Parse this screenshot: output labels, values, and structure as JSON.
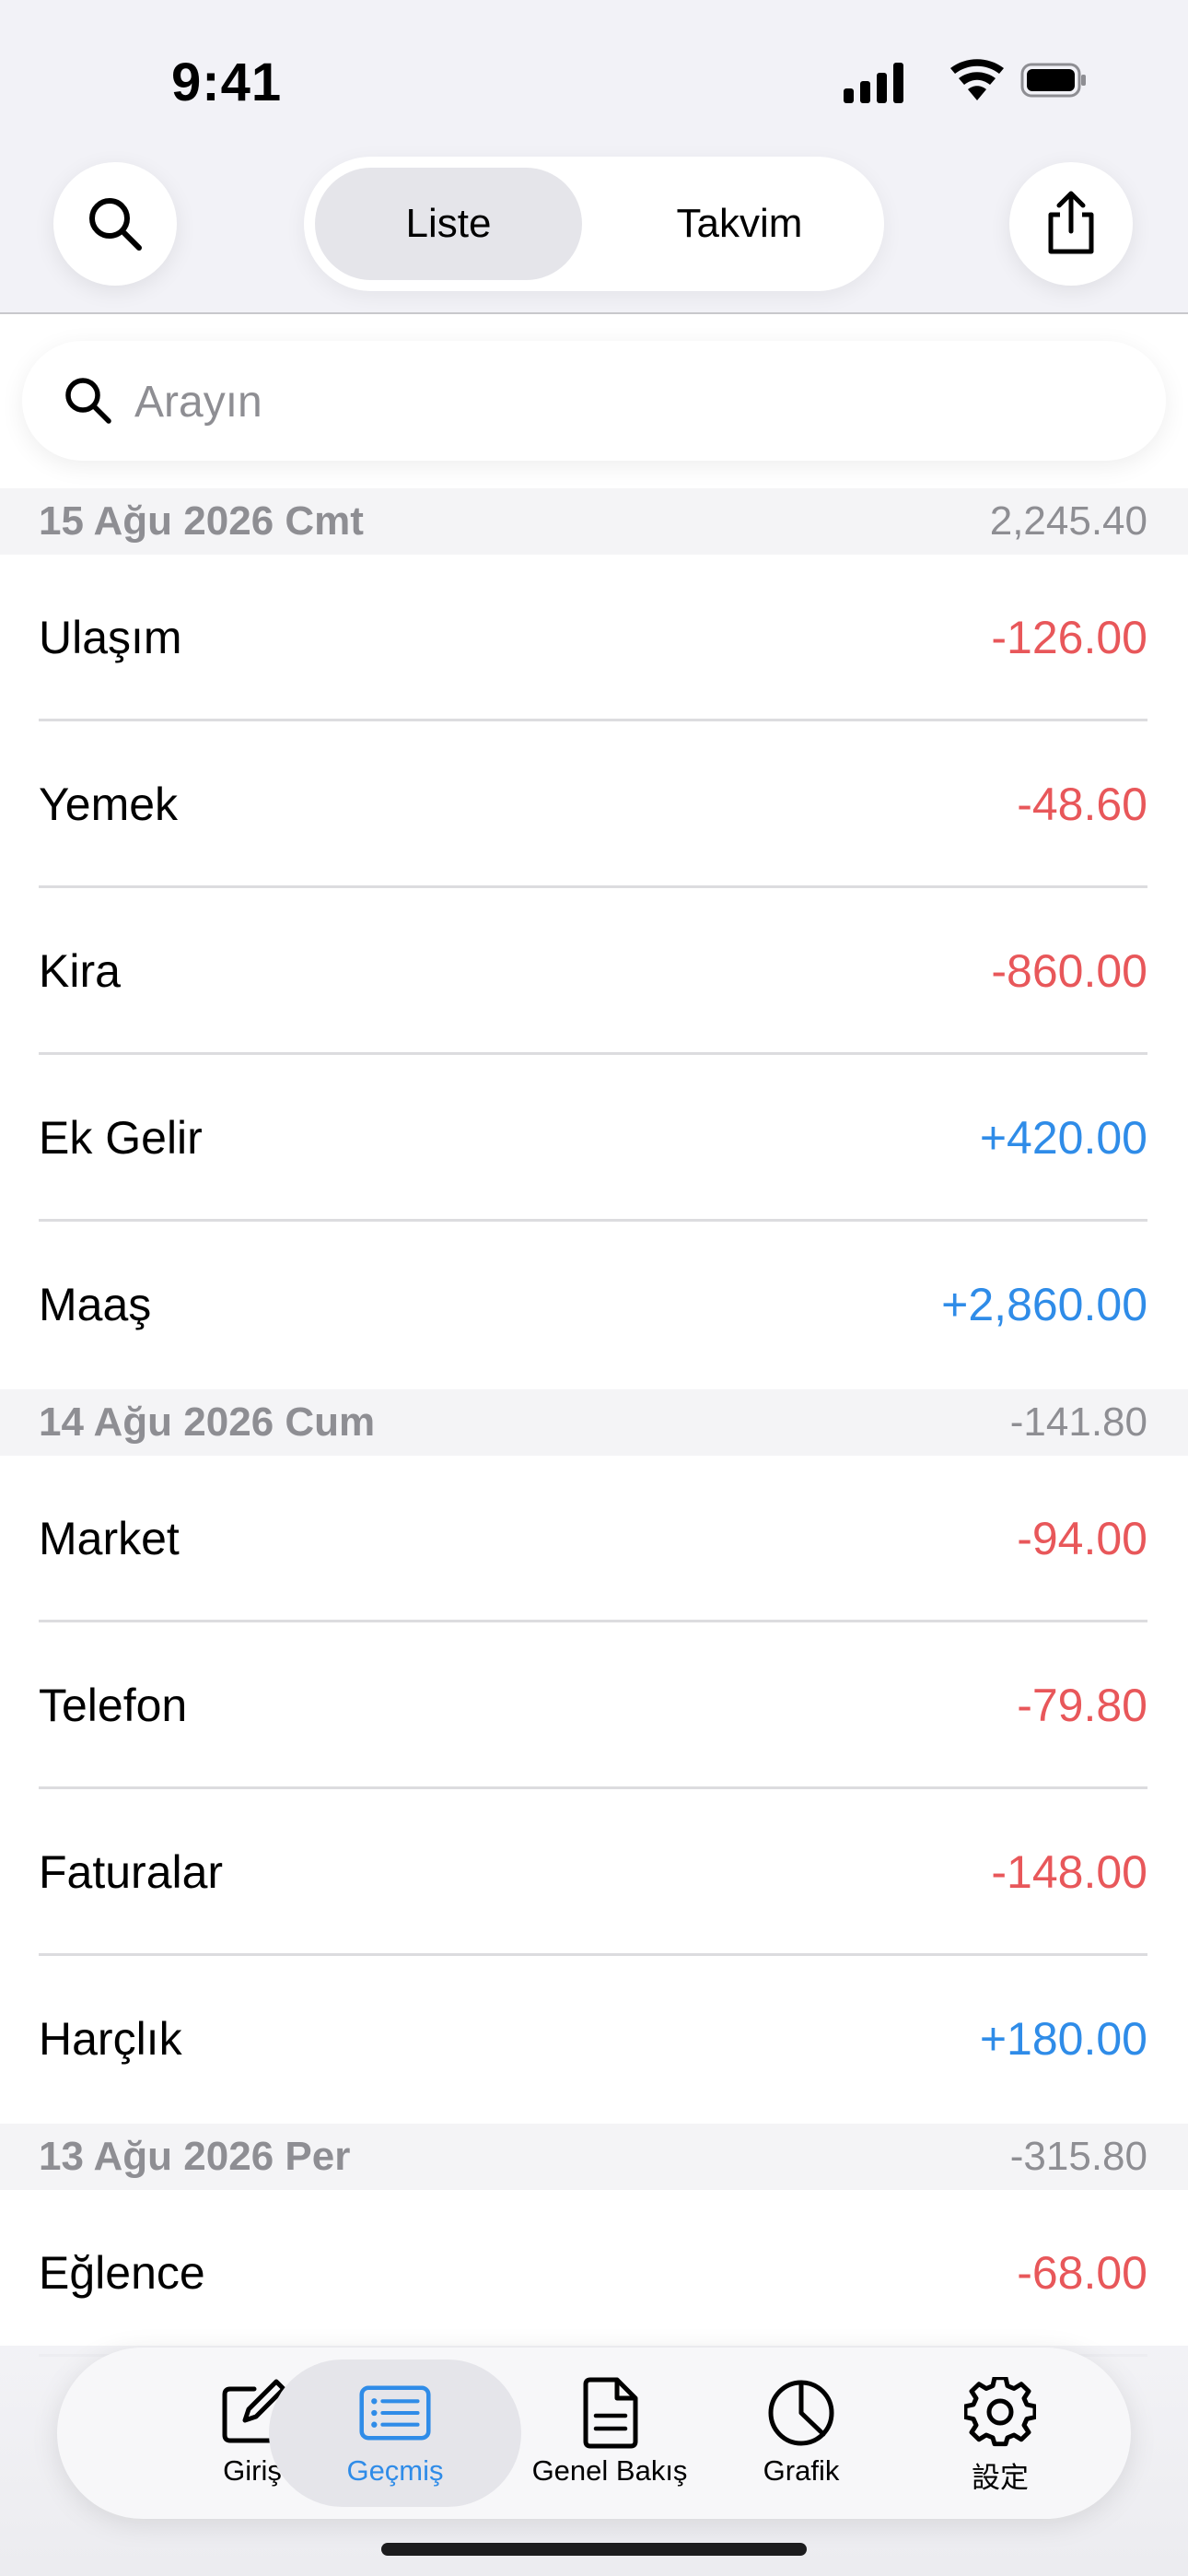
{
  "status": {
    "time": "9:41"
  },
  "header": {
    "segments": [
      "Liste",
      "Takvim"
    ],
    "active_segment": "Liste"
  },
  "search": {
    "placeholder": "Arayın",
    "value": ""
  },
  "sections": [
    {
      "date": "15 Ağu 2026 Cmt",
      "total": "2,245.40",
      "rows": [
        {
          "label": "Ulaşım",
          "amount": "-126.00",
          "type": "expense"
        },
        {
          "label": "Yemek",
          "amount": "-48.60",
          "type": "expense"
        },
        {
          "label": "Kira",
          "amount": "-860.00",
          "type": "expense"
        },
        {
          "label": "Ek Gelir",
          "amount": "+420.00",
          "type": "income"
        },
        {
          "label": "Maaş",
          "amount": "+2,860.00",
          "type": "income"
        }
      ]
    },
    {
      "date": "14 Ağu 2026 Cum",
      "total": "-141.80",
      "rows": [
        {
          "label": "Market",
          "amount": "-94.00",
          "type": "expense"
        },
        {
          "label": "Telefon",
          "amount": "-79.80",
          "type": "expense"
        },
        {
          "label": "Faturalar",
          "amount": "-148.00",
          "type": "expense"
        },
        {
          "label": "Harçlık",
          "amount": "+180.00",
          "type": "income"
        }
      ]
    },
    {
      "date": "13 Ağu 2026 Per",
      "total": "-315.80",
      "rows": [
        {
          "label": "Eğlence",
          "amount": "-68.00",
          "type": "expense"
        }
      ]
    }
  ],
  "tabbar": {
    "items": [
      {
        "label": "Giriş",
        "icon": "compose-icon"
      },
      {
        "label": "Geçmiş",
        "icon": "history-list-icon"
      },
      {
        "label": "Genel Bakış",
        "icon": "document-icon"
      },
      {
        "label": "Grafik",
        "icon": "pie-chart-icon"
      },
      {
        "label": "設定",
        "icon": "gear-icon"
      }
    ],
    "active_index": 1
  },
  "colors": {
    "expense": "#e8575a",
    "income": "#2f8ce8",
    "accent": "#2f8ce8",
    "header_text": "#8e8e93"
  }
}
